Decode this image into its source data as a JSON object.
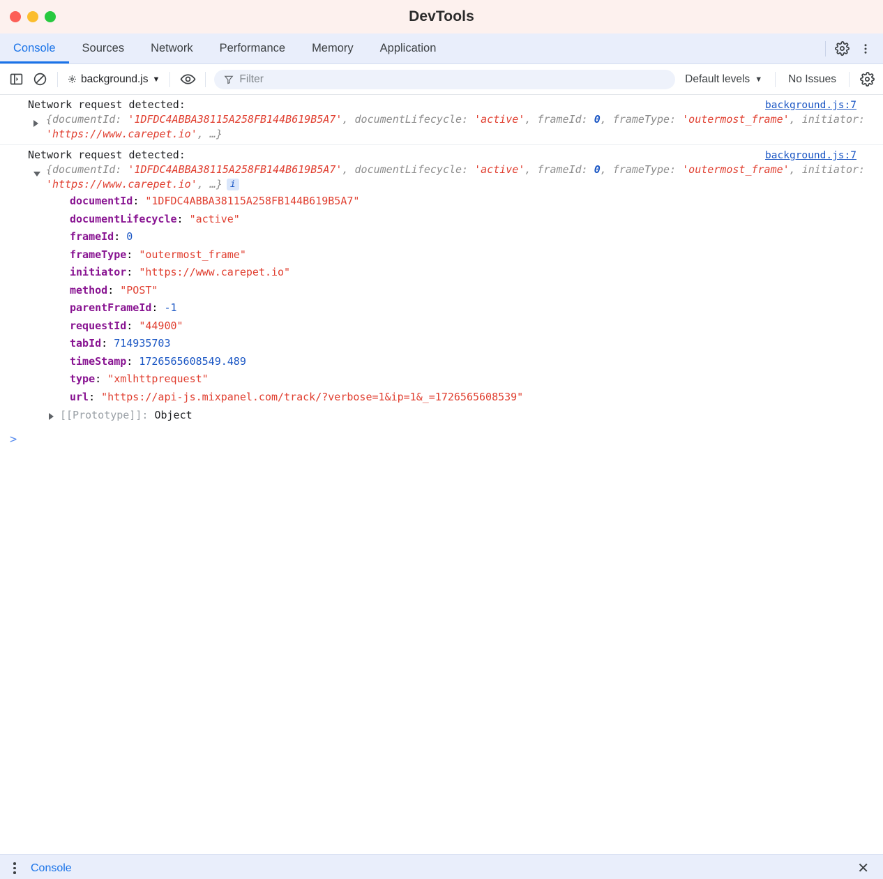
{
  "window": {
    "title": "DevTools",
    "traffic_lights": [
      "close",
      "minimize",
      "zoom"
    ]
  },
  "tabs": [
    {
      "label": "Console",
      "active": true
    },
    {
      "label": "Sources",
      "active": false
    },
    {
      "label": "Network",
      "active": false
    },
    {
      "label": "Performance",
      "active": false
    },
    {
      "label": "Memory",
      "active": false
    },
    {
      "label": "Application",
      "active": false
    }
  ],
  "tabstrip_actions": {
    "settings_icon": "gear-icon",
    "more_icon": "more-vertical-icon"
  },
  "toolbar": {
    "sidebar_icon": "sidebar-toggle-icon",
    "clear_icon": "clear-console-icon",
    "context_label": "background.js",
    "context_icon": "gear-small-icon",
    "context_caret": "▼",
    "eye_icon": "eye-icon",
    "filter_icon": "filter-funnel-icon",
    "filter_placeholder": "Filter",
    "filter_value": "",
    "levels_label": "Default levels",
    "levels_caret": "▼",
    "issues_label": "No Issues",
    "settings_icon": "gear-icon"
  },
  "console": {
    "entries": [
      {
        "message": "Network request detected:",
        "source": "background.js:7",
        "expanded": false,
        "triangle": "▶",
        "preview_parts": [
          {
            "t": "{documentId: ",
            "c": "pk"
          },
          {
            "t": "'1DFDC4ABBA38115A258FB144B619B5A7'",
            "c": "sv"
          },
          {
            "t": ", documentLifecycle: ",
            "c": "pk"
          },
          {
            "t": "'active'",
            "c": "sv"
          },
          {
            "t": ", frameId: ",
            "c": "pk"
          },
          {
            "t": "0",
            "c": "nv"
          },
          {
            "t": ", frameType: ",
            "c": "pk"
          },
          {
            "t": "'outermost_frame'",
            "c": "sv"
          },
          {
            "t": ", initiator: ",
            "c": "pk"
          },
          {
            "t": "'https://www.carepet.io'",
            "c": "sv"
          },
          {
            "t": ", …}",
            "c": "pk"
          }
        ],
        "info_badge": null
      },
      {
        "message": "Network request detected:",
        "source": "background.js:7",
        "expanded": true,
        "triangle": "▼",
        "preview_parts": [
          {
            "t": "{documentId: ",
            "c": "pk"
          },
          {
            "t": "'1DFDC4ABBA38115A258FB144B619B5A7'",
            "c": "sv"
          },
          {
            "t": ", documentLifecycle: ",
            "c": "pk"
          },
          {
            "t": "'active'",
            "c": "sv"
          },
          {
            "t": ", frameId: ",
            "c": "pk"
          },
          {
            "t": "0",
            "c": "nv"
          },
          {
            "t": ", frameType: ",
            "c": "pk"
          },
          {
            "t": "'outermost_frame'",
            "c": "sv"
          },
          {
            "t": ", initiator: ",
            "c": "pk"
          },
          {
            "t": "'https://www.carepet.io'",
            "c": "sv"
          },
          {
            "t": ", …}",
            "c": "pk"
          }
        ],
        "info_badge": "i",
        "properties": [
          {
            "key": "documentId",
            "value": "\"1DFDC4ABBA38115A258FB144B619B5A7\"",
            "kind": "string"
          },
          {
            "key": "documentLifecycle",
            "value": "\"active\"",
            "kind": "string"
          },
          {
            "key": "frameId",
            "value": "0",
            "kind": "number"
          },
          {
            "key": "frameType",
            "value": "\"outermost_frame\"",
            "kind": "string"
          },
          {
            "key": "initiator",
            "value": "\"https://www.carepet.io\"",
            "kind": "string"
          },
          {
            "key": "method",
            "value": "\"POST\"",
            "kind": "string"
          },
          {
            "key": "parentFrameId",
            "value": "-1",
            "kind": "number"
          },
          {
            "key": "requestId",
            "value": "\"44900\"",
            "kind": "string"
          },
          {
            "key": "tabId",
            "value": "714935703",
            "kind": "number"
          },
          {
            "key": "timeStamp",
            "value": "1726565608549.489",
            "kind": "number"
          },
          {
            "key": "type",
            "value": "\"xmlhttprequest\"",
            "kind": "string"
          },
          {
            "key": "url",
            "value": "\"https://api-js.mixpanel.com/track/?verbose=1&ip=1&_=1726565608539\"",
            "kind": "string"
          }
        ],
        "prototype": {
          "name": "[[Prototype]]",
          "value": "Object",
          "triangle": "▶"
        }
      }
    ],
    "prompt": ">"
  },
  "drawer": {
    "menu_icon": "more-vertical-icon",
    "tab_label": "Console",
    "close_icon": "close-icon",
    "close_glyph": "✕"
  }
}
